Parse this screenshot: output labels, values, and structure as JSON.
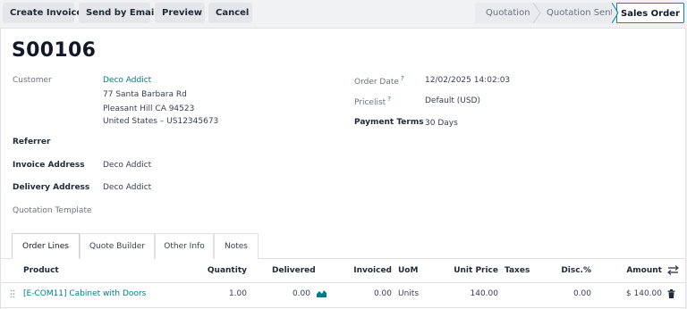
{
  "toolbar": {
    "create_invoice": "Create Invoice",
    "send_by_email": "Send by Email",
    "preview": "Preview",
    "cancel": "Cancel"
  },
  "statusbar": {
    "stages": [
      "Quotation",
      "Quotation Sent",
      "Sales Order"
    ],
    "active": "Sales Order"
  },
  "record": {
    "name": "S00106",
    "customer_label": "Customer",
    "customer_name": "Deco Addict",
    "customer_address": [
      "77 Santa Barbara Rd",
      "Pleasant Hill CA 94523",
      "United States – US12345673"
    ],
    "referrer_label": "Referrer",
    "invoice_address_label": "Invoice Address",
    "invoice_address": "Deco Addict",
    "delivery_address_label": "Delivery Address",
    "delivery_address": "Deco Addict",
    "quotation_template_label": "Quotation Template",
    "order_date_label": "Order Date",
    "order_date": "12/02/2025 14:02:03",
    "pricelist_label": "Pricelist",
    "pricelist": "Default (USD)",
    "payment_terms_label": "Payment Terms",
    "payment_terms": "30 Days",
    "help_mark": "?"
  },
  "tabs": [
    "Order Lines",
    "Quote Builder",
    "Other Info",
    "Notes"
  ],
  "order_lines": {
    "columns": {
      "product": "Product",
      "quantity": "Quantity",
      "delivered": "Delivered",
      "invoiced": "Invoiced",
      "uom": "UoM",
      "unit_price": "Unit Price",
      "taxes": "Taxes",
      "discount": "Disc.%",
      "amount": "Amount"
    },
    "rows": [
      {
        "product": "[E-COM11] Cabinet with Doors",
        "quantity": "1.00",
        "delivered": "0.00",
        "invoiced": "0.00",
        "uom": "Units",
        "unit_price": "140.00",
        "taxes": "",
        "discount": "0.00",
        "amount": "$ 140.00"
      }
    ]
  },
  "colors": {
    "accent": "#017e84",
    "active_stage_border": "#0f8a99"
  }
}
